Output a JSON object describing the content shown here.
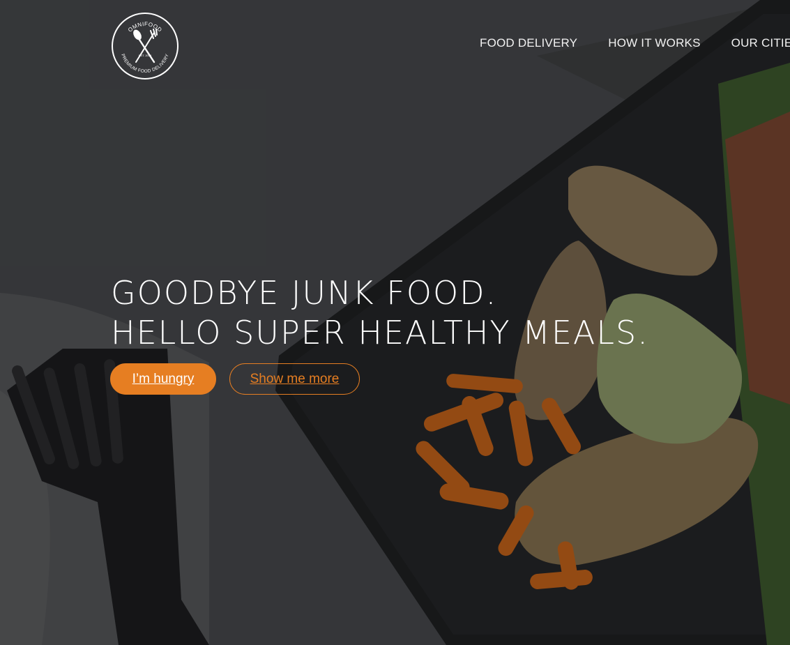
{
  "brand": {
    "name": "OMNIFOOD",
    "tagline": "PREMIUM FOOD DELIVERY",
    "est": "EST. 2016",
    "accent_color": "#e67e22"
  },
  "nav": {
    "items": [
      {
        "label": "FOOD DELIVERY"
      },
      {
        "label": "HOW IT WORKS"
      },
      {
        "label": "OUR CITIES"
      }
    ]
  },
  "hero": {
    "headline_line1": "GOODBYE JUNK FOOD.",
    "headline_line2": "HELLO SUPER HEALTHY MEALS.",
    "primary_button": "I’m hungry",
    "secondary_button": "Show me more"
  }
}
